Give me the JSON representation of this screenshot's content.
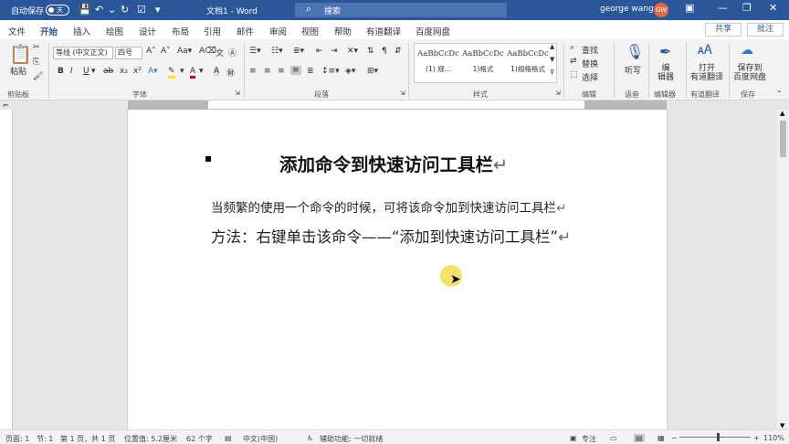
{
  "titlebar": {
    "autosave": "自动保存",
    "toggle_state": "关",
    "doc_title": "文档1 - Word",
    "search_placeholder": "搜索",
    "user_name": "george wang",
    "user_initials": "GW",
    "minimize": "—",
    "restore": "❐",
    "close": "✕"
  },
  "tabs": [
    "文件",
    "开始",
    "插入",
    "绘图",
    "设计",
    "布局",
    "引用",
    "邮件",
    "审阅",
    "视图",
    "帮助",
    "有道翻译",
    "百度网盘"
  ],
  "share_label": "共享",
  "comment_label": "批注",
  "ribbon": {
    "paste": "粘贴",
    "clipboard": "剪贴板",
    "font_name": "等线 (中文正文)",
    "font_size": "四号",
    "font_group": "字体",
    "paragraph_group": "段落",
    "styles": [
      {
        "sample": "AaBbCcDc",
        "name": "(1) 规..."
      },
      {
        "sample": "AaBbCcDc",
        "name": "1)格式"
      },
      {
        "sample": "AaBbCcDc",
        "name": "1)规格格式"
      }
    ],
    "styles_group": "样式",
    "find": "查找",
    "replace": "替换",
    "select": "选择",
    "edit_group": "编辑",
    "dictate": "听写",
    "voice_group": "语音",
    "editor": "编\n辑器",
    "editor_group": "编辑器",
    "open_youdao": "打开\n有道翻译",
    "youdao_group": "有道翻译",
    "save_baidu": "保存到\n百度网盘",
    "save_group": "保存"
  },
  "document": {
    "heading": "添加命令到快速访问工具栏",
    "para1": "当频繁的使用一个命令的时候，可将该命令加到快速访问工具栏",
    "para2": "方法：右键单击该命令——“添加到快速访问工具栏”",
    "return_mark": "↵"
  },
  "status": {
    "page": "页面: 1",
    "section": "节: 1",
    "pages": "第 1 页，共 1 页",
    "position": "位置值: 5.2厘米",
    "words": "62 个字",
    "language": "中文(中国)",
    "accessibility": "辅助功能: 一切就绪",
    "focus": "专注",
    "zoom": "110%"
  }
}
